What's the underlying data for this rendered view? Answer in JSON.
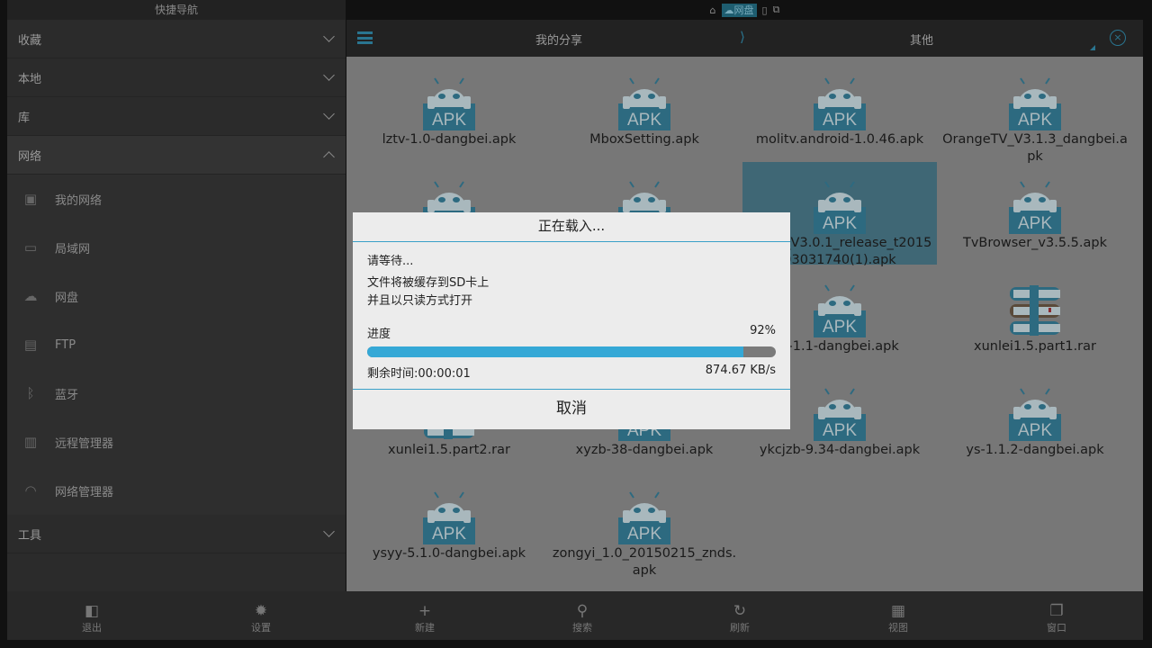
{
  "sidebar": {
    "title": "快捷导航",
    "sections": [
      {
        "label": "收藏"
      },
      {
        "label": "本地"
      },
      {
        "label": "库"
      },
      {
        "label": "网络"
      }
    ],
    "network_items": [
      {
        "label": "我的网络",
        "icon": "my-network-icon"
      },
      {
        "label": "局域网",
        "icon": "lan-icon"
      },
      {
        "label": "网盘",
        "icon": "cloud-icon"
      },
      {
        "label": "FTP",
        "icon": "ftp-icon"
      },
      {
        "label": "蓝牙",
        "icon": "bluetooth-icon"
      },
      {
        "label": "远程管理器",
        "icon": "remote-manager-icon"
      },
      {
        "label": "网络管理器",
        "icon": "wifi-icon"
      }
    ],
    "tools": "工具"
  },
  "status": {
    "active": "网盘"
  },
  "header": {
    "crumb1": "我的分享",
    "crumb2": "其他"
  },
  "files": [
    {
      "name": "lztv-1.0-dangbei.apk",
      "type": "apk"
    },
    {
      "name": "MboxSetting.apk",
      "type": "apk"
    },
    {
      "name": "molitv.android-1.0.46.apk",
      "type": "apk"
    },
    {
      "name": "OrangeTV_V3.1.3_dangbei.apk",
      "type": "apk"
    },
    {
      "name": "",
      "type": "apk"
    },
    {
      "name": "",
      "type": "apk"
    },
    {
      "name": "Video_V3.0.1_release_t201503031740(1).apk",
      "type": "apk",
      "selected": true
    },
    {
      "name": "TvBrowser_v3.5.5.apk",
      "type": "apk"
    },
    {
      "name": "",
      "type": "apk"
    },
    {
      "name": "",
      "type": "apk"
    },
    {
      "name": "y-1.1-dangbei.apk",
      "type": "apk"
    },
    {
      "name": "xunlei1.5.part1.rar",
      "type": "rar"
    },
    {
      "name": "xunlei1.5.part2.rar",
      "type": "rar"
    },
    {
      "name": "xyzb-38-dangbei.apk",
      "type": "apk"
    },
    {
      "name": "ykcjzb-9.34-dangbei.apk",
      "type": "apk"
    },
    {
      "name": "ys-1.1.2-dangbei.apk",
      "type": "apk"
    },
    {
      "name": "ysyy-5.1.0-dangbei.apk",
      "type": "apk"
    },
    {
      "name": "zongyi_1.0_20150215_znds.apk",
      "type": "apk"
    }
  ],
  "bottom": [
    {
      "label": "退出",
      "icon": "exit-icon",
      "glyph": "◧"
    },
    {
      "label": "设置",
      "icon": "gear-icon",
      "glyph": "✹"
    },
    {
      "label": "新建",
      "icon": "plus-icon",
      "glyph": "+"
    },
    {
      "label": "搜索",
      "icon": "search-icon",
      "glyph": "⚲"
    },
    {
      "label": "刷新",
      "icon": "refresh-icon",
      "glyph": "↻"
    },
    {
      "label": "视图",
      "icon": "grid-view-icon",
      "glyph": "▦"
    },
    {
      "label": "窗口",
      "icon": "windows-icon",
      "glyph": "❐"
    }
  ],
  "dialog": {
    "title": "正在载入...",
    "wait": "请等待...",
    "line1": "文件将被缓存到SD卡上",
    "line2": "并且以只读方式打开",
    "progress_label": "进度",
    "progress_text": "92%",
    "progress": 92,
    "remaining": "剩余时间:00:00:01",
    "speed": "874.67 KB/s",
    "cancel": "取消"
  },
  "colors": {
    "accent": "#35a8d6",
    "icon_blue": "#2d6a80"
  }
}
